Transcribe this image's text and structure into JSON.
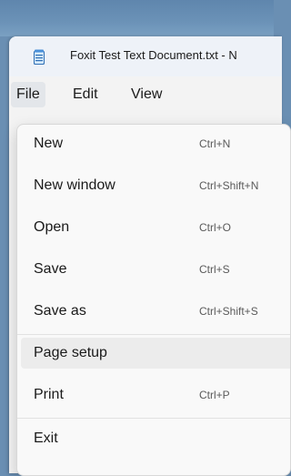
{
  "window": {
    "title": "Foxit Test Text Document.txt - N",
    "app_icon": "notepad-icon"
  },
  "menubar": {
    "items": [
      {
        "label": "File",
        "active": true
      },
      {
        "label": "Edit",
        "active": false
      },
      {
        "label": "View",
        "active": false
      }
    ]
  },
  "file_menu": {
    "items": [
      {
        "label": "New",
        "shortcut": "Ctrl+N"
      },
      {
        "label": "New window",
        "shortcut": "Ctrl+Shift+N"
      },
      {
        "label": "Open",
        "shortcut": "Ctrl+O"
      },
      {
        "label": "Save",
        "shortcut": "Ctrl+S"
      },
      {
        "label": "Save as",
        "shortcut": "Ctrl+Shift+S"
      },
      {
        "label": "Page setup",
        "shortcut": "",
        "highlighted": true
      },
      {
        "label": "Print",
        "shortcut": "Ctrl+P"
      },
      {
        "label": "Exit",
        "shortcut": ""
      }
    ]
  },
  "colors": {
    "menu_background": "#f9f9f9",
    "highlight": "#ececec",
    "title_bar": "#eef2f8"
  }
}
